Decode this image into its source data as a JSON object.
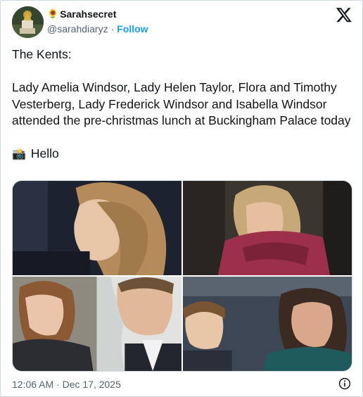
{
  "author": {
    "flower_emoji": "🌻",
    "display_name": "Sarahsecret",
    "handle": "@sarahdiaryz",
    "separator": "·",
    "follow_label": "Follow"
  },
  "tweet": {
    "heading": "The Kents:",
    "body": "Lady Amelia Windsor,  Lady Helen Taylor, Flora and Timothy Vesterberg, Lady Frederick Windsor and Isabella Windsor attended the pre-christmas lunch at Buckingham Palace today",
    "camera_emoji": "📸",
    "closing": "Hello"
  },
  "media": {
    "photo_count": 4
  },
  "footer": {
    "timestamp": "12:06 AM · Dec 17, 2025"
  },
  "icons": {
    "brand": "x-logo-icon",
    "info": "info-icon"
  }
}
